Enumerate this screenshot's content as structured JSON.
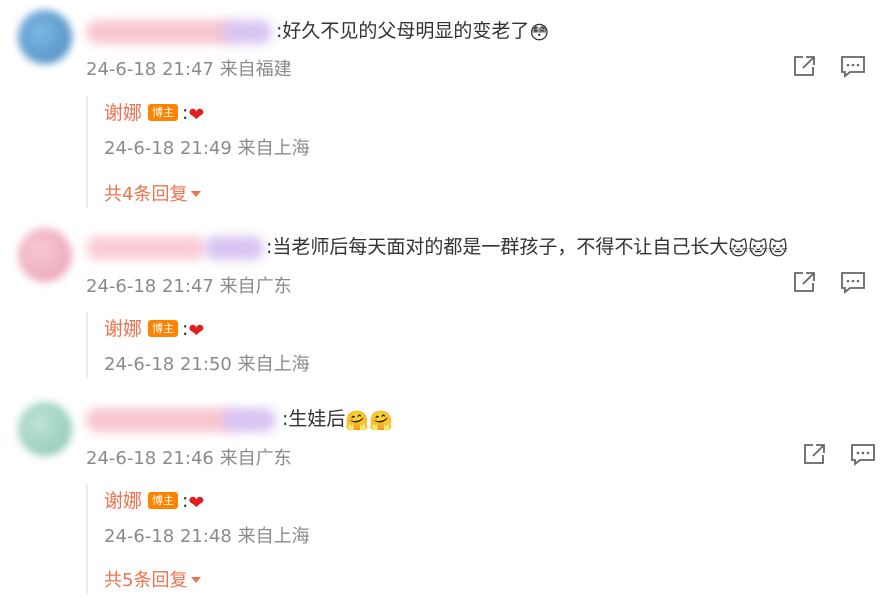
{
  "comments": [
    {
      "text": ":好久不见的父母明显的变老了",
      "emoji": "😳",
      "meta": "24-6-18 21:47 来自福建",
      "avatar_color": "#5b9fd4",
      "name_color": "#f7c6cf",
      "name_color2": "#d8c4f2",
      "reply": {
        "author": "谢娜",
        "badge": "博主",
        "text": ":",
        "emoji": "❤",
        "meta": "24-6-18 21:49 来自上海",
        "more": "共4条回复"
      }
    },
    {
      "text": ":当老师后每天面对的都是一群孩子，不得不让自己长大",
      "emoji": "🐱🐱🐱",
      "meta": "24-6-18 21:47 来自广东",
      "avatar_color": "#f2b3c4",
      "name_color": "#f9cdd6",
      "name_color2": "#d8c4f2",
      "reply": {
        "author": "谢娜",
        "badge": "博主",
        "text": ":",
        "emoji": "❤",
        "meta": "24-6-18 21:50 来自上海",
        "more": ""
      }
    },
    {
      "text": ":生娃后",
      "emoji": "🤗🤗",
      "meta": "24-6-18 21:46 来自广东",
      "avatar_color": "#9fd3c4",
      "name_color": "#f7c6cf",
      "name_color2": "#d8c4f2",
      "reply": {
        "author": "谢娜",
        "badge": "博主",
        "text": ":",
        "emoji": "❤",
        "meta": "24-6-18 21:48 来自上海",
        "more": "共5条回复"
      }
    }
  ],
  "icons": {
    "share": "share-icon",
    "comment": "comment-icon"
  }
}
